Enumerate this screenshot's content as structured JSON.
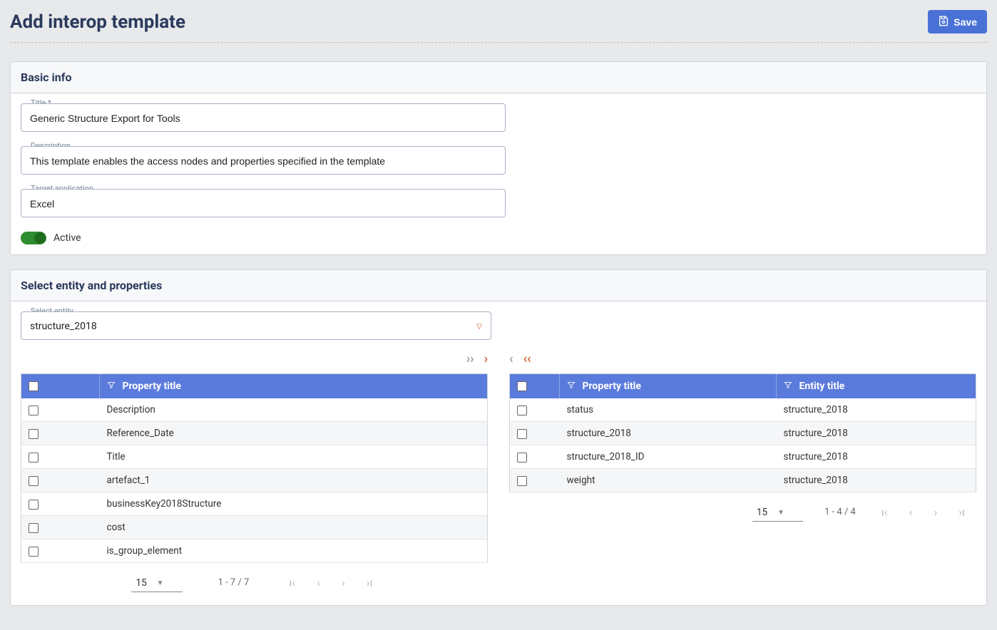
{
  "header": {
    "title": "Add interop template",
    "save_label": "Save"
  },
  "basic_info": {
    "heading": "Basic info",
    "title_label": "Title *",
    "title_value": "Generic Structure Export for Tools",
    "desc_label": "Description",
    "desc_value": "This template enables the access nodes and properties specified in the template",
    "target_label": "Target application",
    "target_value": "Excel",
    "active_label": "Active"
  },
  "selection": {
    "heading": "Select entity and properties",
    "select_entity_label": "Select entity",
    "select_entity_value": "structure_2018",
    "left": {
      "col_property": "Property title",
      "rows": [
        "Description",
        "Reference_Date",
        "Title",
        "artefact_1",
        "businessKey2018Structure",
        "cost",
        "is_group_element"
      ],
      "page_size": "15",
      "range": "1 - 7 / 7"
    },
    "right": {
      "col_property": "Property title",
      "col_entity": "Entity title",
      "rows": [
        {
          "p": "status",
          "e": "structure_2018"
        },
        {
          "p": "structure_2018",
          "e": "structure_2018"
        },
        {
          "p": "structure_2018_ID",
          "e": "structure_2018"
        },
        {
          "p": "weight",
          "e": "structure_2018"
        }
      ],
      "page_size": "15",
      "range": "1 - 4 / 4"
    }
  }
}
